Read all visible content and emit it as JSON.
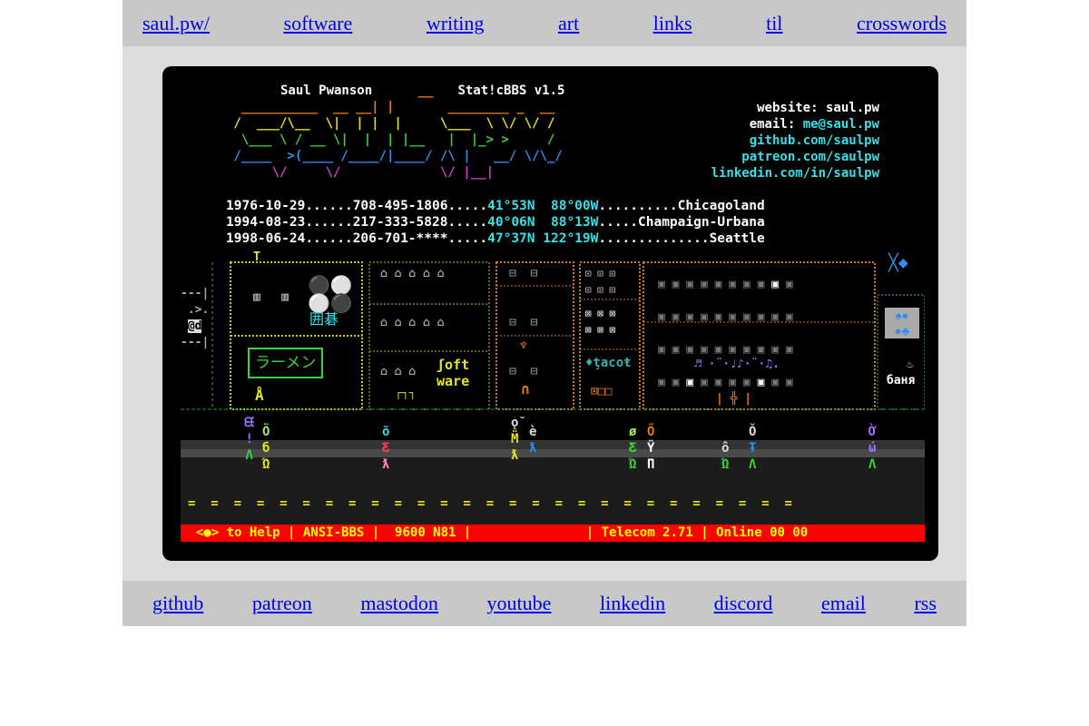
{
  "top_nav": [
    "saul.pw/",
    "software",
    "writing",
    "art",
    "links",
    "til",
    "crosswords"
  ],
  "bottom_nav": [
    "github",
    "patreon",
    "mastodon",
    "youtube",
    "linkedin",
    "discord",
    "email",
    "rss"
  ],
  "header": {
    "name": "Saul Pwanson",
    "bbs": "Stat!cBBS v1.5"
  },
  "contact": {
    "website_label": "website:",
    "website": "saul.pw",
    "email_label": "email:",
    "email": "me@saul.pw",
    "github": "github.com/saulpw",
    "patreon": "patreon.com/saulpw",
    "linkedin": "linkedin.com/in/saulpw"
  },
  "timeline": [
    {
      "date": "1976-10-29",
      "phone": "708-495-1806",
      "lat": "41°53N",
      "lon": " 88°00W",
      "place": "Chicagoland",
      "fill1": "......",
      "fill2": ".....",
      "fill3": ".........."
    },
    {
      "date": "1994-08-23",
      "phone": "217-333-5828",
      "lat": "40°06N",
      "lon": " 88°13W",
      "place": "Champaign-Urbana",
      "fill1": "......",
      "fill2": ".....",
      "fill3": "....."
    },
    {
      "date": "1998-06-24",
      "phone": "206-701-****",
      "lat": "47°37N",
      "lon": "122°19W",
      "place": "Seattle",
      "fill1": "......",
      "fill2": ".....",
      "fill3": ".............."
    }
  ],
  "city_signs": {
    "go": "囲碁",
    "ramen": "ラーメン",
    "software_1": "ʃoft",
    "software_2": "ware",
    "taco": "♦ţacoŧ",
    "banya": "баня"
  },
  "status_bar": {
    "help": "<●> to Help",
    "mode": "ANSI-BBS",
    "baud": "9600 N81",
    "term": "Telecom 2.71",
    "online": "Online 00 00"
  }
}
